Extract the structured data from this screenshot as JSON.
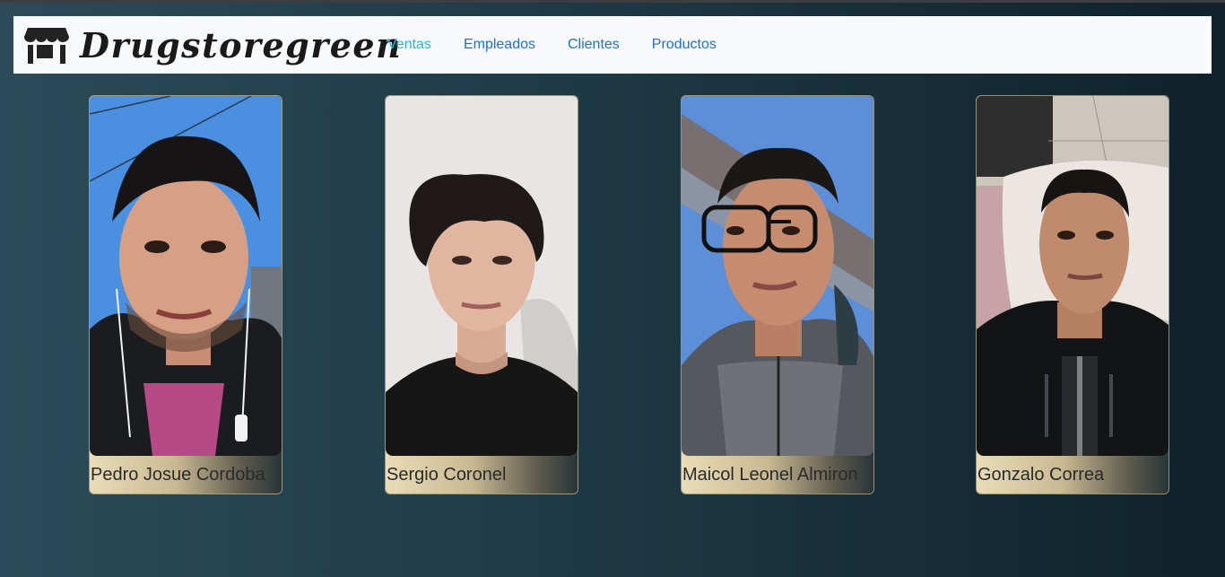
{
  "brand": {
    "name": "Drugstoregreen",
    "icon": "store-icon"
  },
  "nav": [
    {
      "label": "Ventas",
      "active": true
    },
    {
      "label": "Empleados",
      "active": false
    },
    {
      "label": "Clientes",
      "active": false
    },
    {
      "label": "Productos",
      "active": false
    }
  ],
  "employees": [
    {
      "name": "Pedro Josue Cordoba",
      "photo": "portrait-photo"
    },
    {
      "name": "Sergio Coronel",
      "photo": "portrait-photo"
    },
    {
      "name": "Maicol Leonel Almiron",
      "photo": "portrait-photo"
    },
    {
      "name": "Gonzalo Correa",
      "photo": "portrait-photo"
    }
  ],
  "colors": {
    "accent_active": "#22b8d6",
    "link": "#1e6fd9",
    "navbar_bg": "#f8f9fa"
  }
}
